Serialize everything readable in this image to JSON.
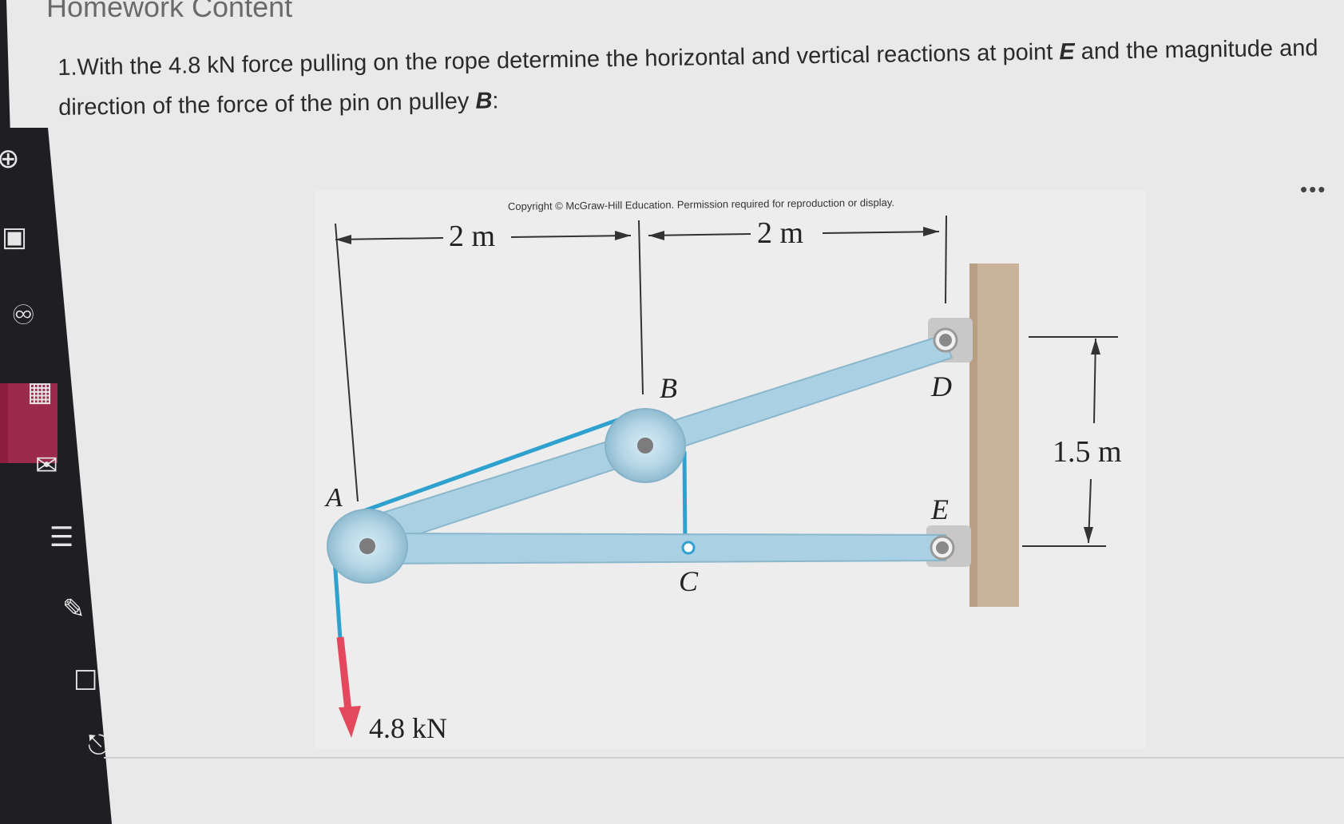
{
  "page": {
    "title": "Homework Content"
  },
  "question": {
    "number": "1.",
    "text_before_E": "With the 4.8 kN force pulling on the rope determine the horizontal and vertical reactions at point ",
    "point_E": "E",
    "text_between": " and the magnitude and direction of the force of the pin on pulley ",
    "point_B": "B",
    "text_end": ":"
  },
  "figure": {
    "copyright": "Copyright © McGraw-Hill Education. Permission required for reproduction or display.",
    "dim_left": "2 m",
    "dim_right": "2 m",
    "dim_vertical": "1.5 m",
    "label_A": "A",
    "label_B": "B",
    "label_C": "C",
    "label_D": "D",
    "label_E": "E",
    "force_label": "4.8 kN",
    "colors": {
      "member": "#a9d0e3",
      "rope": "#2fa1cf",
      "force": "#e4485c",
      "wall": "#c9b39a"
    }
  },
  "sidebar": {
    "icons": [
      "globe-icon",
      "tray-icon",
      "users-icon",
      "calendar-icon",
      "mail-icon",
      "notes-icon",
      "tools-icon",
      "edit-icon",
      "logout-icon"
    ]
  }
}
